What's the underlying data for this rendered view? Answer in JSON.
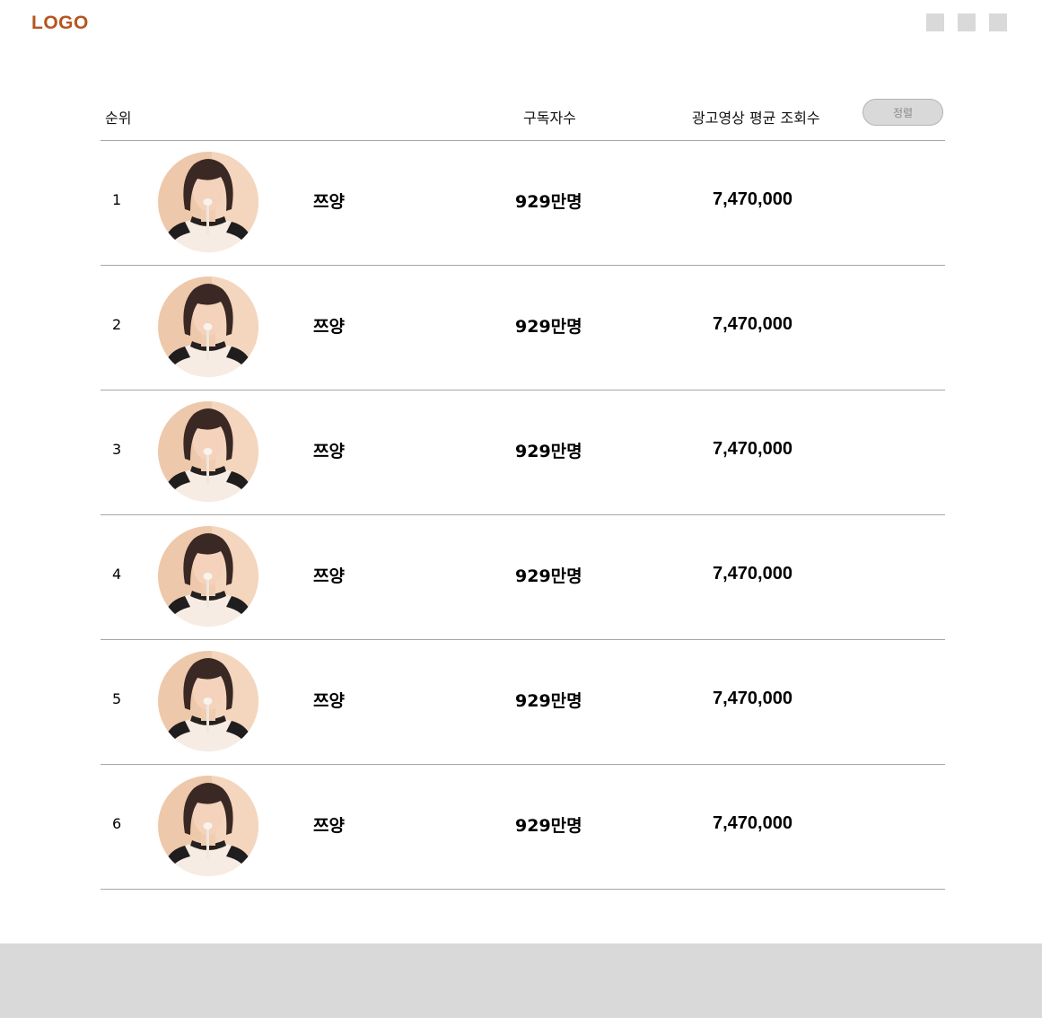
{
  "header": {
    "logo": "LOGO"
  },
  "table": {
    "columns": {
      "rank": "순위",
      "subscribers": "구독자수",
      "avg_views": "광고영상 평균 조회수"
    },
    "sort_label": "정렬",
    "rows": [
      {
        "rank": "1",
        "name": "쯔양",
        "subscribers": "929만명",
        "avg_views": "7,470,000"
      },
      {
        "rank": "2",
        "name": "쯔양",
        "subscribers": "929만명",
        "avg_views": "7,470,000"
      },
      {
        "rank": "3",
        "name": "쯔양",
        "subscribers": "929만명",
        "avg_views": "7,470,000"
      },
      {
        "rank": "4",
        "name": "쯔양",
        "subscribers": "929만명",
        "avg_views": "7,470,000"
      },
      {
        "rank": "5",
        "name": "쯔양",
        "subscribers": "929만명",
        "avg_views": "7,470,000"
      },
      {
        "rank": "6",
        "name": "쯔양",
        "subscribers": "929만명",
        "avg_views": "7,470,000"
      }
    ]
  }
}
